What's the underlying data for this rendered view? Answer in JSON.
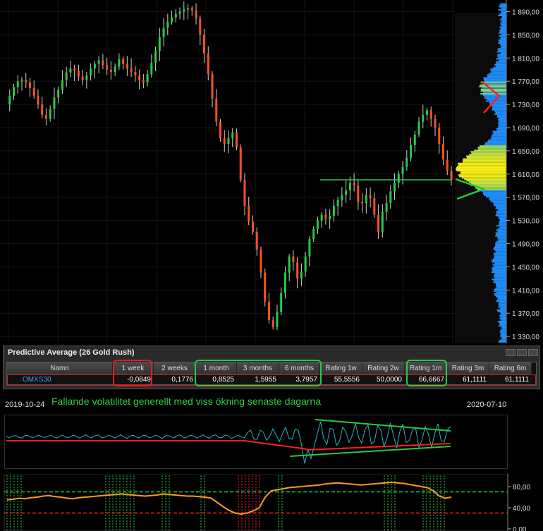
{
  "chart_data": [
    {
      "type": "candlestick",
      "y_ticks": [
        "1 890,00",
        "1 850,00",
        "1 810,00",
        "1 770,00",
        "1 730,00",
        "1 690,00",
        "1 650,00",
        "1 610,00",
        "1 570,00",
        "1 530,00",
        "1 490,00",
        "1 450,00",
        "1 410,00",
        "1 370,00",
        "1 330,00"
      ],
      "y_tick_values": [
        1890,
        1850,
        1810,
        1770,
        1730,
        1690,
        1650,
        1610,
        1570,
        1530,
        1490,
        1450,
        1410,
        1370,
        1330
      ],
      "ylim": [
        1318,
        1910
      ],
      "close_path": [
        1730,
        1745,
        1760,
        1770,
        1772,
        1768,
        1758,
        1745,
        1730,
        1712,
        1705,
        1722,
        1742,
        1755,
        1772,
        1785,
        1792,
        1788,
        1778,
        1772,
        1780,
        1792,
        1800,
        1806,
        1798,
        1790,
        1786,
        1795,
        1808,
        1800,
        1792,
        1786,
        1780,
        1772,
        1768,
        1782,
        1802,
        1822,
        1846,
        1862,
        1872,
        1880,
        1886,
        1890,
        1894,
        1896,
        1892,
        1878,
        1850,
        1818,
        1782,
        1740,
        1700,
        1672,
        1662,
        1672,
        1682,
        1656,
        1600,
        1555,
        1528,
        1510,
        1480,
        1440,
        1390,
        1358,
        1346,
        1372,
        1405,
        1440,
        1468,
        1458,
        1430,
        1442,
        1468,
        1498,
        1515,
        1530,
        1540,
        1532,
        1538,
        1555,
        1565,
        1574,
        1582,
        1595,
        1590,
        1562,
        1560,
        1574,
        1568,
        1540,
        1510,
        1545,
        1560,
        1580,
        1595,
        1610,
        1622,
        1638,
        1660,
        1678,
        1700,
        1712,
        1720,
        1705,
        1690,
        1662,
        1635,
        1615,
        1600
      ],
      "horizontal_level": 1600,
      "series": [
        {
          "name": "volume profile",
          "color": "#1e90ff"
        }
      ]
    },
    {
      "type": "line",
      "series": [
        {
          "name": "volatility",
          "color": "#27b3c8"
        },
        {
          "name": "avg-red",
          "color": "#ff2020"
        },
        {
          "name": "avg-green",
          "color": "#22cc44"
        }
      ]
    },
    {
      "type": "line",
      "y_ticks": [
        "80,00",
        "40,00",
        "0,00"
      ],
      "y_tick_values": [
        80,
        40,
        0
      ],
      "ylim": [
        0,
        100
      ],
      "levels": [
        {
          "value": 70,
          "color": "#22cc44"
        },
        {
          "value": 30,
          "color": "#ff2020"
        }
      ],
      "oscillator": [
        55,
        56,
        58,
        57,
        59,
        60,
        62,
        63,
        61,
        60,
        58,
        57,
        59,
        60,
        61,
        62,
        63,
        64,
        65,
        66,
        65,
        64,
        63,
        62,
        63,
        64,
        66,
        65,
        64,
        63,
        62,
        62,
        61,
        60,
        58,
        50,
        42,
        35,
        30,
        28,
        30,
        34,
        40,
        60,
        72,
        74,
        76,
        78,
        79,
        80,
        81,
        82,
        83,
        85,
        86,
        87,
        86,
        85,
        84,
        83,
        84,
        85,
        86,
        87,
        88,
        87,
        86,
        84,
        82,
        80,
        78,
        72,
        62,
        58,
        60
      ]
    }
  ],
  "panel": {
    "title": "Predictive Average (26  Gold Rush)",
    "headers": [
      "Namn",
      "1 week",
      "2 weeks",
      "1 month",
      "3 months",
      "6 months",
      "Rating 1w",
      "Rating 2w",
      "Rating 1m",
      "Rating 3m",
      "Rating 6m"
    ],
    "row": {
      "name": "OMXS30",
      "values": [
        "-0,0849",
        "0,1776",
        "0,8525",
        "1,5955",
        "3,7957",
        "55,5556",
        "50,0000",
        "66,6667",
        "61,1111",
        "61,1111"
      ]
    }
  },
  "dates": {
    "left": "2019-10-24",
    "right": "2020-07-10"
  },
  "comment": "Fallande volatilitet generellt med viss ökning senaste dagarna",
  "colors": {
    "up": "#22cc44",
    "down": "#ff5020",
    "highlight_red": "#e02020",
    "highlight_green": "#22cc44",
    "name_link": "#3aa0ff"
  }
}
